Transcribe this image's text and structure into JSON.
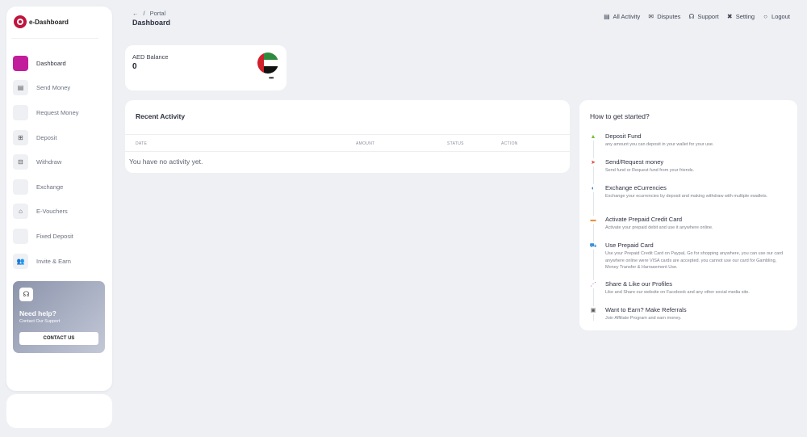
{
  "brand": {
    "name": "e-Dashboard",
    "accent": "#c0143c"
  },
  "sidebar": {
    "items": [
      {
        "label": "Dashboard",
        "icon": "dashboard-icon",
        "glyph": "",
        "active": true
      },
      {
        "label": "Send Money",
        "icon": "send-money-icon",
        "glyph": "▤",
        "active": false
      },
      {
        "label": "Request Money",
        "icon": "request-money-icon",
        "glyph": "",
        "active": false
      },
      {
        "label": "Deposit",
        "icon": "deposit-icon",
        "glyph": "⊞",
        "active": false
      },
      {
        "label": "Withdraw",
        "icon": "withdraw-icon",
        "glyph": "⊟",
        "active": false
      },
      {
        "label": "Exchange",
        "icon": "exchange-icon",
        "glyph": "",
        "active": false
      },
      {
        "label": "E-Vouchers",
        "icon": "voucher-icon",
        "glyph": "⌂",
        "active": false
      },
      {
        "label": "Fixed Deposit",
        "icon": "fixed-deposit-icon",
        "glyph": "",
        "active": false
      },
      {
        "label": "Invite & Earn",
        "icon": "invite-icon",
        "glyph": "👥",
        "active": false
      }
    ],
    "active_color": "#c21e9b"
  },
  "help": {
    "title": "Need help?",
    "subtitle": "Contact Our Support",
    "button": "CONTACT US",
    "icon": "headset-icon"
  },
  "header": {
    "back": "←",
    "separator": "/",
    "crumb": "Portal",
    "title": "Dashboard"
  },
  "topnav": [
    {
      "label": "All Activity",
      "icon": "activity-icon",
      "glyph": "▤"
    },
    {
      "label": "Disputes",
      "icon": "envelope-icon",
      "glyph": "✉"
    },
    {
      "label": "Support",
      "icon": "headset-icon",
      "glyph": "☊"
    },
    {
      "label": "Setting",
      "icon": "tools-icon",
      "glyph": "✖"
    },
    {
      "label": "Logout",
      "icon": "power-icon",
      "glyph": "○"
    }
  ],
  "balance": {
    "label": "AED Balance",
    "value": "0",
    "more": "•••",
    "flag": "uae-flag-icon"
  },
  "activity": {
    "title": "Recent Activity",
    "columns": [
      "DATE",
      "AMOUNT",
      "STATUS",
      "ACTION"
    ],
    "empty": "You have no activity yet."
  },
  "started": {
    "title": "How to get started?",
    "steps": [
      {
        "title": "Deposit Fund",
        "desc": "any amount you can deposit in your wallet for your use.",
        "icon": "deposit-step-icon",
        "glyph": "▲",
        "color": "#6fbf3a"
      },
      {
        "title": "Send/Request money",
        "desc": "Send fund or Request fund from your friends.",
        "icon": "paper-plane-icon",
        "glyph": "➤",
        "color": "#e0443a"
      },
      {
        "title": "Exchange eCurrencies",
        "desc": "Exchange your ecurrencies by deposit and making withdraw with multiple ewallets.",
        "icon": "exchange-step-icon",
        "glyph": "◐",
        "color": "#2e7fd6"
      },
      {
        "title": "Activate Prepaid Credit Card",
        "desc": "Activate your prepaid debit and use it anywhere online.",
        "icon": "credit-card-icon",
        "glyph": "▬",
        "color": "#e8913a"
      },
      {
        "title": "Use Prepaid Card",
        "desc": "Use your Prepaid Credit Card on Paypal, Go for shopping anywhere, you can use our card anywhere online were VISA cards are accepted. you cannot use our card for Gambling, Money Transfer & Harrasement Use.",
        "icon": "cart-icon",
        "glyph": "⛟",
        "color": "#3a8fd6"
      },
      {
        "title": "Share & Like our Profiles",
        "desc": "Like and Share our website on Facebook and any other social media site.",
        "icon": "share-icon",
        "glyph": "⋰",
        "color": "#a12aa6"
      },
      {
        "title": "Want to Earn? Make Referrals",
        "desc": "Join Affiliate Program and earn money.",
        "icon": "referral-icon",
        "glyph": "▣",
        "color": "#555555"
      }
    ]
  }
}
